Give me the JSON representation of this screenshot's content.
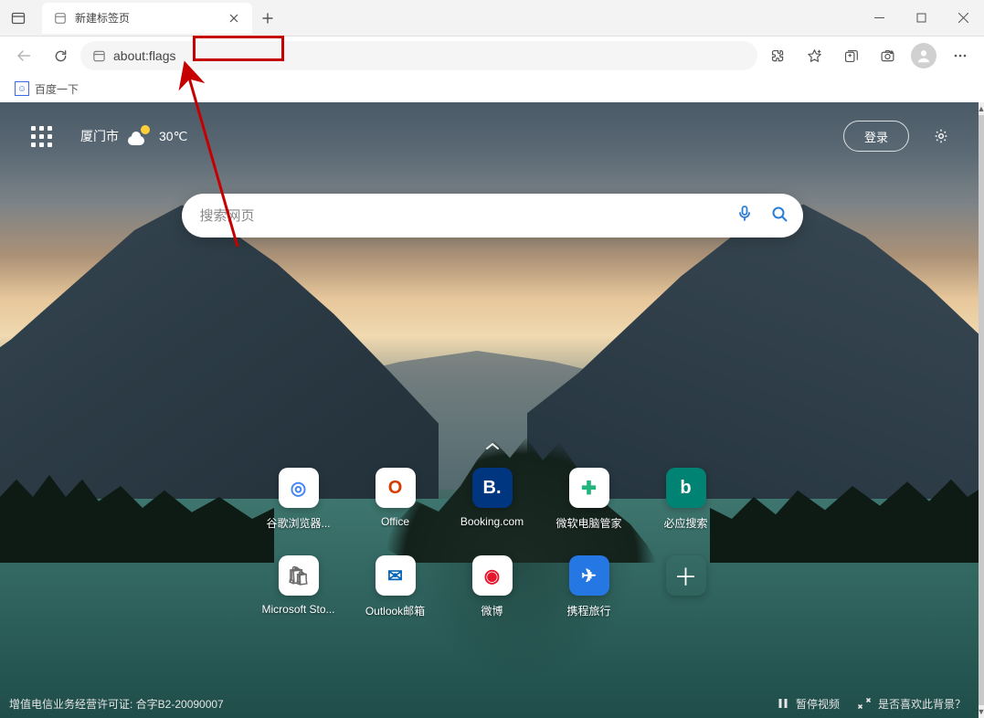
{
  "tab": {
    "title": "新建标签页"
  },
  "toolbar": {
    "url": "about:flags"
  },
  "bookmarks": {
    "baidu": "百度一下"
  },
  "ntp": {
    "weather": {
      "city": "厦门市",
      "temp": "30℃"
    },
    "login_label": "登录",
    "search_placeholder": "搜索网页",
    "quicklinks_row1": [
      {
        "label": "谷歌浏览器...",
        "bg": "#ffffff",
        "color": "#4285f4",
        "glyph": "◎"
      },
      {
        "label": "Office",
        "bg": "#ffffff",
        "color": "#d83b01",
        "glyph": "O"
      },
      {
        "label": "Booking.com",
        "bg": "#003580",
        "color": "#ffffff",
        "glyph": "B."
      },
      {
        "label": "微软电脑管家",
        "bg": "#ffffff",
        "color": "#24b47e",
        "glyph": "✚"
      },
      {
        "label": "必应搜索",
        "bg": "#008373",
        "color": "#ffffff",
        "glyph": "b"
      }
    ],
    "quicklinks_row2": [
      {
        "label": "Microsoft Sto...",
        "bg": "#ffffff",
        "color": "#6b6b6b",
        "glyph": "🛍"
      },
      {
        "label": "Outlook邮箱",
        "bg": "#ffffff",
        "color": "#0364b8",
        "glyph": "✉"
      },
      {
        "label": "微博",
        "bg": "#ffffff",
        "color": "#e6162d",
        "glyph": "◉"
      },
      {
        "label": "携程旅行",
        "bg": "#2577e3",
        "color": "#ffffff",
        "glyph": "✈"
      }
    ],
    "footer": {
      "license": "增值电信业务经营许可证: 合字B2-20090007",
      "pause": "暂停视频",
      "like": "是否喜欢此背景？"
    }
  }
}
